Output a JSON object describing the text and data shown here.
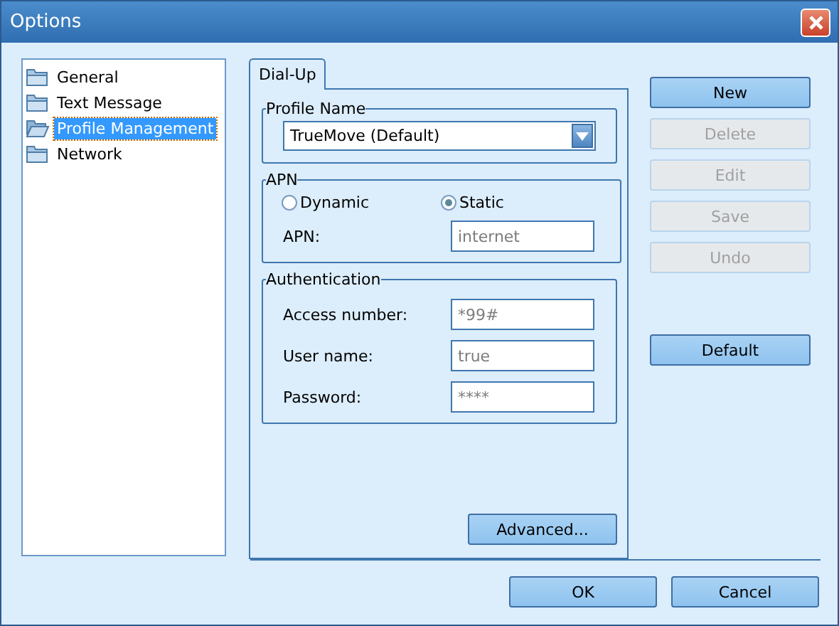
{
  "window": {
    "title": "Options"
  },
  "tree": {
    "items": [
      {
        "label": "General",
        "selected": false
      },
      {
        "label": "Text Message",
        "selected": false
      },
      {
        "label": "Profile Management",
        "selected": true
      },
      {
        "label": "Network",
        "selected": false
      }
    ]
  },
  "tabs": [
    {
      "label": "Dial-Up",
      "selected": true
    }
  ],
  "profile_name": {
    "title": "Profile Name",
    "value": "TrueMove (Default)"
  },
  "apn": {
    "title": "APN",
    "options": [
      {
        "label": "Dynamic",
        "selected": false
      },
      {
        "label": "Static",
        "selected": true
      }
    ],
    "label": "APN:",
    "value": "internet"
  },
  "authentication": {
    "title": "Authentication",
    "fields": [
      {
        "label": "Access number:",
        "value": "*99#"
      },
      {
        "label": "User name:",
        "value": "true"
      },
      {
        "label": "Password:",
        "value": "****"
      }
    ]
  },
  "advanced_button": "Advanced...",
  "side_buttons": [
    {
      "label": "New",
      "disabled": false
    },
    {
      "label": "Delete",
      "disabled": true
    },
    {
      "label": "Edit",
      "disabled": true
    },
    {
      "label": "Save",
      "disabled": true
    },
    {
      "label": "Undo",
      "disabled": true
    }
  ],
  "default_button": "Default",
  "buttons": [
    "OK",
    "Cancel"
  ]
}
